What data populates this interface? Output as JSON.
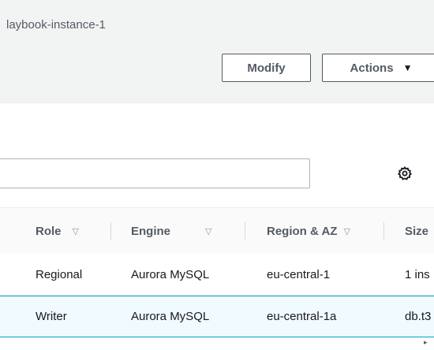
{
  "header": {
    "instance_name": "laybook-instance-1",
    "modify_label": "Modify",
    "actions_label": "Actions",
    "actions_caret": "▼"
  },
  "filter": {
    "placeholder": ""
  },
  "icons": {
    "settings": "gear-icon",
    "sort": "sort-caret-icon",
    "scroll_right": "scroll-right-icon"
  },
  "table": {
    "columns": [
      {
        "label": "Role",
        "sort": "▽"
      },
      {
        "label": "Engine",
        "sort": "▽"
      },
      {
        "label": "Region & AZ",
        "sort": "▽"
      },
      {
        "label": "Size",
        "sort": ""
      }
    ],
    "rows": [
      {
        "role": "Regional",
        "engine": "Aurora MySQL",
        "region": "eu-central-1",
        "size": "1 ins"
      },
      {
        "role": "Writer",
        "engine": "Aurora MySQL",
        "region": "eu-central-1a",
        "size": "db.t3"
      }
    ]
  },
  "scrollbar": {
    "arrow": "▸"
  },
  "colors": {
    "accent": "#00a1c9",
    "selected_row": "#f1faff",
    "text": "#16191f",
    "muted": "#545b64"
  }
}
